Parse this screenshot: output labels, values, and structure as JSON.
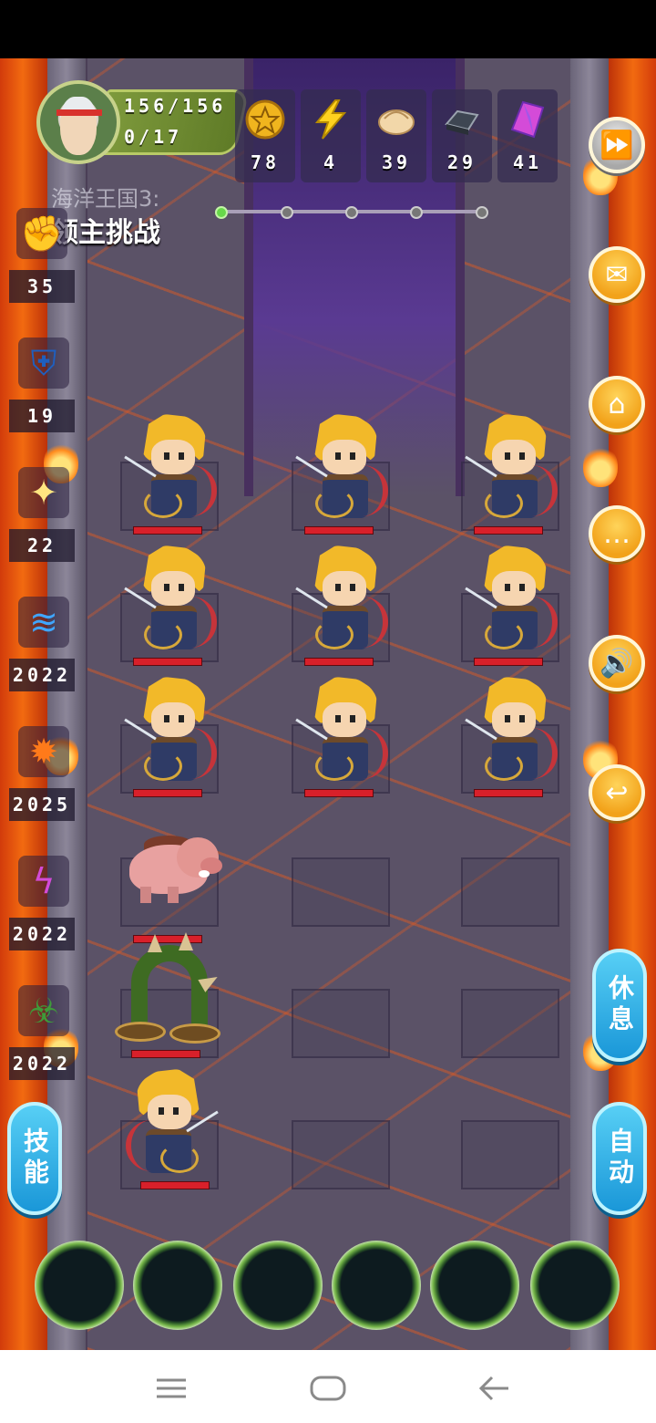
{
  "player": {
    "hp": "156/156",
    "energy": "0/17"
  },
  "resources": [
    {
      "name": "gold-coin-icon",
      "value": "78"
    },
    {
      "name": "lightning-icon",
      "value": "4"
    },
    {
      "name": "dumpling-icon",
      "value": "39"
    },
    {
      "name": "iron-ingot-icon",
      "value": "29"
    },
    {
      "name": "crystal-gem-icon",
      "value": "41"
    }
  ],
  "level": {
    "title": "海洋王国3:",
    "subtitle": "领主挑战",
    "progress_dots": 5,
    "current_dot": 1
  },
  "skills": [
    {
      "icon": "fist-icon",
      "value": "35"
    },
    {
      "icon": "shield-icon",
      "value": "19"
    },
    {
      "icon": "holy-light-icon",
      "value": "22"
    },
    {
      "icon": "water-wave-icon",
      "value": "2022"
    },
    {
      "icon": "fire-burst-icon",
      "value": "2025"
    },
    {
      "icon": "lightning-rune-icon",
      "value": "2022"
    },
    {
      "icon": "poison-icon",
      "value": "2022"
    }
  ],
  "right_buttons": [
    "fast-forward-icon",
    "mail-icon",
    "home-icon",
    "chat-icon",
    "sound-icon",
    "return-icon"
  ],
  "actions": {
    "rest": "休息",
    "auto": "自动",
    "skill": "技能"
  },
  "units": {
    "enemies": "blonde-swordsman",
    "boar": "wild-boar",
    "worm": "spiked-sandworm",
    "player_hero": "blonde-swordsman"
  },
  "colors": {
    "hp_bar": "#d8202a",
    "accent": "#f2a21a",
    "button_blue": "#1a97d8",
    "lava": "#f26a10"
  }
}
